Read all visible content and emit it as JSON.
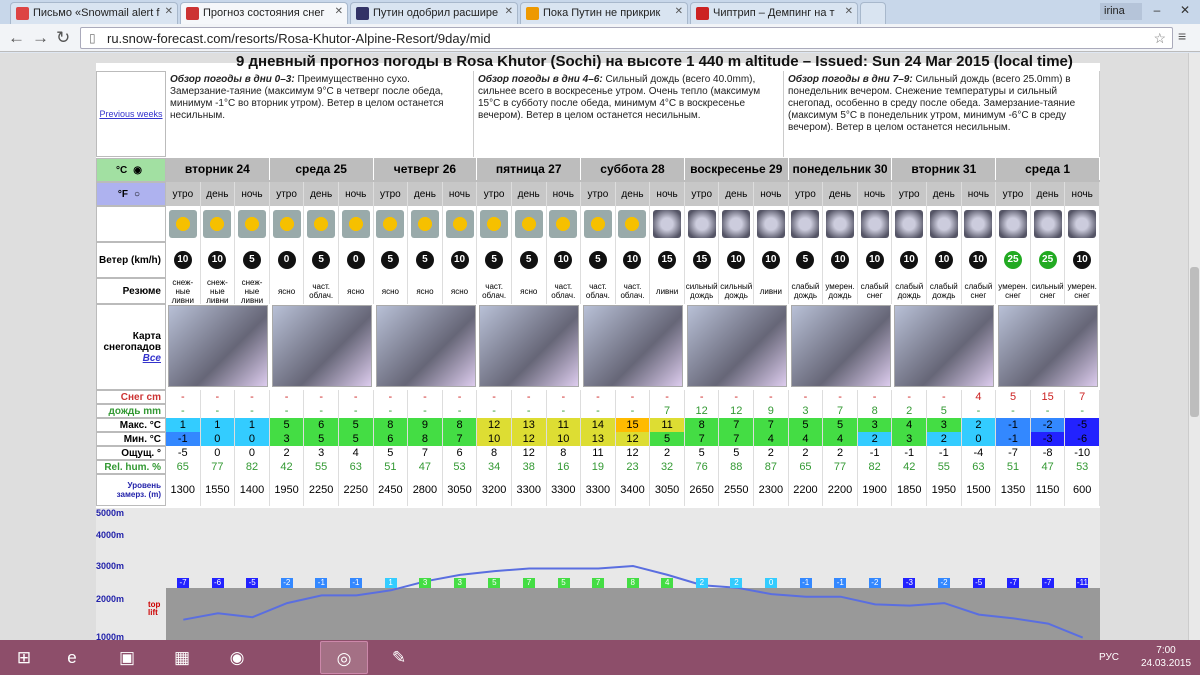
{
  "tabs": [
    {
      "title": "Письмо «Snowmail alert f",
      "color": "#d44"
    },
    {
      "title": "Прогноз состояния снег",
      "color": "#c33"
    },
    {
      "title": "Путин одобрил расшире",
      "color": "#336"
    },
    {
      "title": "Пока Путин не прикрик",
      "color": "#e90"
    },
    {
      "title": "Чиптрип – Демпинг на т",
      "color": "#c22"
    }
  ],
  "user": "irina",
  "url": "ru.snow-forecast.com/resorts/Rosa-Khutor-Alpine-Resort/9day/mid",
  "headline": "9 дневный прогноз погоды в Rosa Khutor (Sochi) на высоте 1 440 m altitude – Issued: Sun 24 Mar 2015 (local time)",
  "previous_weeks": "Previous weeks",
  "overview": [
    {
      "title": "Обзор погоды в дни 0&ndash;3:",
      "text": " Преимущественно сухо. Замерзание-таяние (максимум 9°C в четверг после обеда, минимум -1°C во вторник утром). Ветер в целом останется несильным."
    },
    {
      "title": "Обзор погоды в дни 4&ndash;6:",
      "text": " Сильный дождь (всего 40.0mm), сильнее всего в воскресенье утром. Очень тепло (максимум 15°C в субботу после обеда, минимум 4°C в воскресенье вечером). Ветер в целом останется несильным."
    },
    {
      "title": "Обзор погоды в дни 7&ndash;9:",
      "text": " Сильный дождь (всего 25.0mm) в понедельник вечером. Снежение температуры и сильный снегопад, особенно в среду после обеда. Замерзание-таяние (максимум 5°C в понедельник утром, минимум -6°C в среду вечером). Ветер в целом останется несильным."
    }
  ],
  "units": {
    "c": "°C",
    "f": "°F"
  },
  "days": [
    "вторник 24",
    "среда 25",
    "четверг 26",
    "пятница 27",
    "суббота 28",
    "воскресенье 29",
    "понедельник 30",
    "вторник 31",
    "среда 1"
  ],
  "periods": [
    "утро",
    "день",
    "ночь"
  ],
  "labels": {
    "wind": "Ветер (km/h)",
    "summary": "Резюме",
    "map": "Карта снегопадов",
    "all": "Все",
    "snow": "Снег cm",
    "rain": "дождь mm",
    "max": "Макс. °C",
    "min": "Мин. °C",
    "feel": "Ощущ. °",
    "hum": "Rel. hum. %",
    "freeze": "Уровень замерз. (m)"
  },
  "wind": [
    "10",
    "10",
    "5",
    "0",
    "5",
    "0",
    "5",
    "5",
    "10",
    "5",
    "5",
    "10",
    "5",
    "10",
    "15",
    "15",
    "10",
    "10",
    "5",
    "10",
    "10",
    "10",
    "10",
    "10",
    "25",
    "25",
    "10"
  ],
  "summary": [
    "снеж-ные ливни",
    "снеж-ные ливни",
    "снеж-ные ливни",
    "ясно",
    "част. облач.",
    "ясно",
    "ясно",
    "ясно",
    "ясно",
    "част. облач.",
    "ясно",
    "част. облач.",
    "част. облач.",
    "част. облач.",
    "ливни",
    "сильный дождь",
    "сильный дождь",
    "ливни",
    "слабый дождь",
    "умерен. дождь",
    "слабый снег",
    "слабый дождь",
    "слабый дождь",
    "слабый снег",
    "умерен. снег",
    "сильный снег",
    "умерен. снег"
  ],
  "snow": [
    "-",
    "-",
    "-",
    "-",
    "-",
    "-",
    "-",
    "-",
    "-",
    "-",
    "-",
    "-",
    "-",
    "-",
    "-",
    "-",
    "-",
    "-",
    "-",
    "-",
    "-",
    "-",
    "-",
    "4",
    "5",
    "15",
    "7"
  ],
  "rain": [
    "-",
    "-",
    "-",
    "-",
    "-",
    "-",
    "-",
    "-",
    "-",
    "-",
    "-",
    "-",
    "-",
    "-",
    "7",
    "12",
    "12",
    "9",
    "3",
    "7",
    "8",
    "2",
    "5",
    "-",
    "-",
    "-",
    "-"
  ],
  "max": [
    "1",
    "1",
    "1",
    "5",
    "6",
    "5",
    "8",
    "9",
    "8",
    "12",
    "13",
    "11",
    "14",
    "15",
    "11",
    "8",
    "7",
    "7",
    "5",
    "5",
    "3",
    "4",
    "3",
    "2",
    "-1",
    "-2",
    "-5"
  ],
  "min": [
    "-1",
    "0",
    "0",
    "3",
    "5",
    "5",
    "6",
    "8",
    "7",
    "10",
    "12",
    "10",
    "13",
    "12",
    "5",
    "7",
    "7",
    "4",
    "4",
    "4",
    "2",
    "3",
    "2",
    "0",
    "-1",
    "-3",
    "-6"
  ],
  "feel": [
    "-5",
    "0",
    "0",
    "2",
    "3",
    "4",
    "5",
    "7",
    "6",
    "8",
    "12",
    "8",
    "11",
    "12",
    "2",
    "5",
    "5",
    "2",
    "2",
    "2",
    "-1",
    "-1",
    "-1",
    "-4",
    "-7",
    "-8",
    "-10"
  ],
  "hum": [
    "65",
    "77",
    "82",
    "42",
    "55",
    "63",
    "51",
    "47",
    "53",
    "34",
    "38",
    "16",
    "19",
    "23",
    "32",
    "76",
    "88",
    "87",
    "65",
    "77",
    "82",
    "42",
    "55",
    "63",
    "51",
    "47",
    "53"
  ],
  "freeze": [
    "1300",
    "1550",
    "1400",
    "1950",
    "2250",
    "2250",
    "2450",
    "2800",
    "3050",
    "3200",
    "3300",
    "3300",
    "3300",
    "3400",
    "3050",
    "2650",
    "2550",
    "2300",
    "2200",
    "2200",
    "1900",
    "1850",
    "1950",
    "1500",
    "1350",
    "1150",
    "600"
  ],
  "chart": {
    "levels": [
      "5000m",
      "4000m",
      "3000m",
      "2000m",
      "1000m"
    ],
    "top_lift": "top lift",
    "flags": [
      "-7",
      "-6",
      "-5",
      "-2",
      "-1",
      "-1",
      "1",
      "3",
      "3",
      "5",
      "7",
      "5",
      "7",
      "8",
      "4",
      "2",
      "2",
      "0",
      "-1",
      "-1",
      "-2",
      "-3",
      "-2",
      "-5",
      "-7",
      "-7",
      "-11"
    ]
  },
  "taskbar": {
    "lang": "РУС",
    "time": "7:00",
    "date": "24.03.2015"
  }
}
